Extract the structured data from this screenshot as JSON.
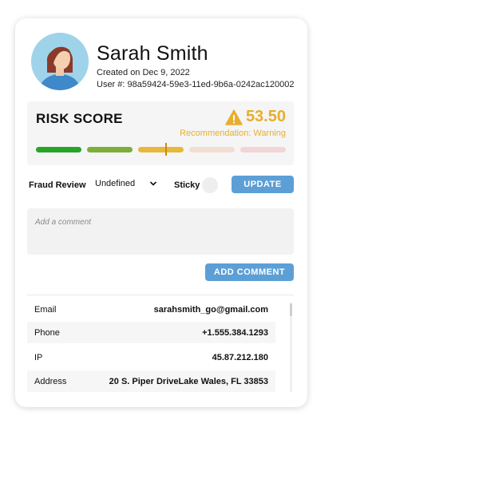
{
  "profile": {
    "name": "Sarah Smith",
    "created": "Created on Dec 9, 2022",
    "user_id": "User #: 98a59424-59e3-11ed-9b6a-0242ac120002",
    "avatar_icon": "user-avatar-icon"
  },
  "risk": {
    "title": "RISK SCORE",
    "score": "53.50",
    "recommendation": "Recommendation: Warning",
    "warning_icon": "warning-triangle-icon",
    "score_color": "#e8ae2c",
    "segments": [
      {
        "color": "#27a527"
      },
      {
        "color": "#7cae3a"
      },
      {
        "color": "#e8b83c"
      },
      {
        "color": "#f2ded0"
      },
      {
        "color": "#f2d5d7"
      }
    ]
  },
  "controls": {
    "fraud_review_label": "Fraud Review",
    "fraud_review_value": "Undefined",
    "sticky_label": "Sticky",
    "update_label": "UPDATE",
    "comment_placeholder": "Add a comment",
    "add_comment_label": "ADD COMMENT",
    "button_color": "#5c9fd6"
  },
  "details": [
    {
      "label": "Email",
      "value": "sarahsmith_go@gmail.com"
    },
    {
      "label": "Phone",
      "value": "+1.555.384.1293"
    },
    {
      "label": "IP",
      "value": "45.87.212.180"
    },
    {
      "label": "Address",
      "value": "20 S. Piper DriveLake Wales, FL 33853"
    }
  ]
}
